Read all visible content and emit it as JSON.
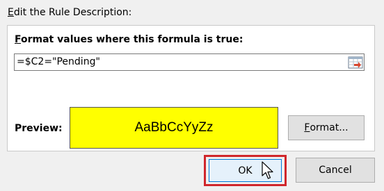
{
  "section": {
    "label_first": "E",
    "label_rest": "dit the Rule Description:"
  },
  "rule": {
    "formula_label_first": "F",
    "formula_label_rest": "ormat values where this formula is true:",
    "formula_value": "=$C2=\"Pending\"",
    "ref_icon": "collapse-range-icon"
  },
  "preview": {
    "label": "Preview:",
    "sample_text": "AaBbCcYyZz",
    "fill_color": "#ffff00",
    "format_button_first": "F",
    "format_button_rest": "ormat..."
  },
  "footer": {
    "ok_label": "OK",
    "cancel_label": "Cancel",
    "highlight_color": "#d0262b"
  }
}
